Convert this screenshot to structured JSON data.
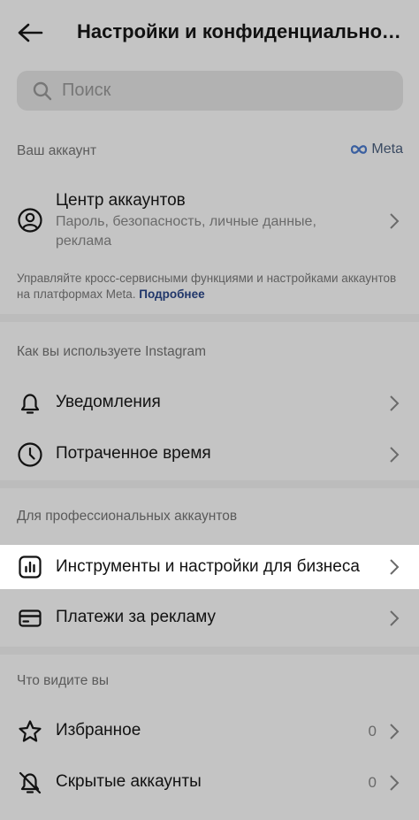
{
  "header": {
    "title": "Настройки и конфиденциальность"
  },
  "search": {
    "placeholder": "Поиск"
  },
  "sections": {
    "account": {
      "label": "Ваш аккаунт",
      "brand": "Meta",
      "accounts_center": {
        "title": "Центр аккаунтов",
        "subtitle": "Пароль, безопасность, личные данные, реклама"
      },
      "note": "Управляйте кросс-сервисными функциями и настройками аккаунтов на платформах Meta.",
      "note_link": "Подробнее"
    },
    "usage": {
      "label": "Как вы используете Instagram",
      "items": [
        {
          "label": "Уведомления",
          "icon": "bell-icon"
        },
        {
          "label": "Потраченное время",
          "icon": "clock-icon"
        }
      ]
    },
    "pro": {
      "label": "Для профессиональных аккаунтов",
      "items": [
        {
          "label": "Инструменты и настройки для бизнеса",
          "icon": "chart-icon"
        },
        {
          "label": "Платежи за рекламу",
          "icon": "card-icon"
        }
      ]
    },
    "seen": {
      "label": "Что видите вы",
      "items": [
        {
          "label": "Избранное",
          "icon": "star-icon",
          "count": "0"
        },
        {
          "label": "Скрытые аккаунты",
          "icon": "muted-bell-icon",
          "count": "0"
        }
      ]
    }
  },
  "colors": {
    "overlay": "#c4c4c4",
    "highlight": "#ffffff",
    "link": "#20366a"
  }
}
